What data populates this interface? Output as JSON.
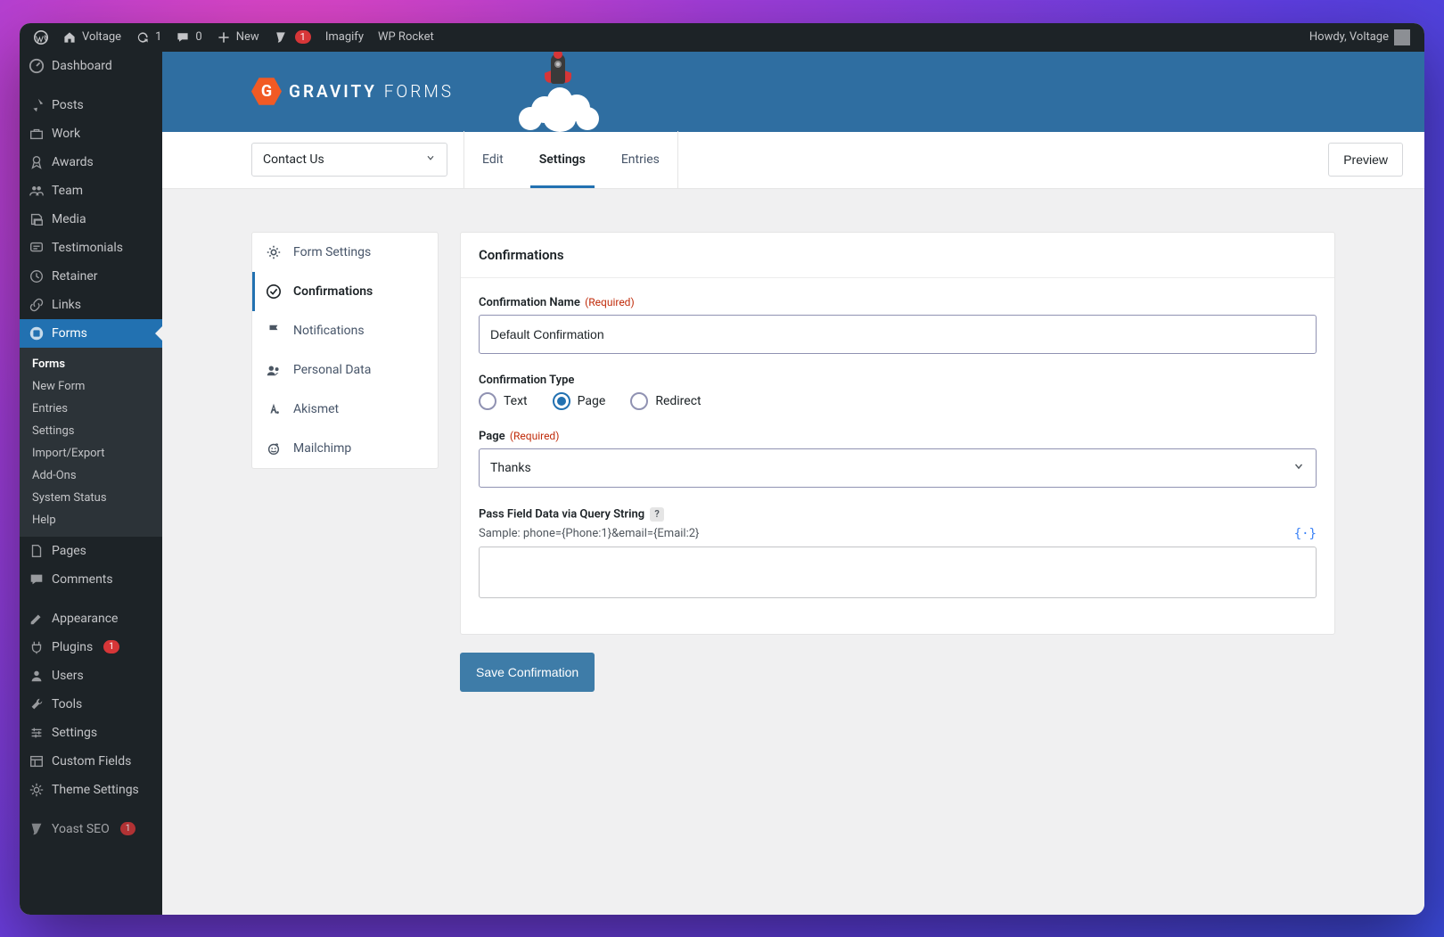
{
  "adminbar": {
    "site": "Voltage",
    "updates": "1",
    "comments": "0",
    "new": "New",
    "yoast_badge": "1",
    "imagify": "Imagify",
    "wp_rocket": "WP Rocket",
    "howdy": "Howdy, Voltage"
  },
  "sidebar": {
    "items": [
      {
        "label": "Dashboard",
        "icon": "dashboard"
      },
      {
        "label": "Posts",
        "icon": "pin"
      },
      {
        "label": "Work",
        "icon": "briefcase"
      },
      {
        "label": "Awards",
        "icon": "award"
      },
      {
        "label": "Team",
        "icon": "team"
      },
      {
        "label": "Media",
        "icon": "media"
      },
      {
        "label": "Testimonials",
        "icon": "quote"
      },
      {
        "label": "Retainer",
        "icon": "clock"
      },
      {
        "label": "Links",
        "icon": "link"
      },
      {
        "label": "Forms",
        "icon": "forms",
        "current": true
      },
      {
        "label": "Pages",
        "icon": "pages"
      },
      {
        "label": "Comments",
        "icon": "comment"
      },
      {
        "label": "Appearance",
        "icon": "appearance"
      },
      {
        "label": "Plugins",
        "icon": "plugin",
        "badge": "1"
      },
      {
        "label": "Users",
        "icon": "user"
      },
      {
        "label": "Tools",
        "icon": "tools"
      },
      {
        "label": "Settings",
        "icon": "settings"
      },
      {
        "label": "Custom Fields",
        "icon": "fields"
      },
      {
        "label": "Theme Settings",
        "icon": "gear"
      },
      {
        "label": "Yoast SEO",
        "icon": "yoast",
        "badge": "1"
      }
    ],
    "submenu": [
      {
        "label": "Forms",
        "current": true
      },
      {
        "label": "New Form"
      },
      {
        "label": "Entries"
      },
      {
        "label": "Settings"
      },
      {
        "label": "Import/Export"
      },
      {
        "label": "Add-Ons"
      },
      {
        "label": "System Status"
      },
      {
        "label": "Help"
      }
    ]
  },
  "banner": {
    "brand_bold": "GRAVITY",
    "brand_light": "FORMS"
  },
  "nav": {
    "form_name": "Contact Us",
    "tabs": [
      {
        "label": "Edit"
      },
      {
        "label": "Settings",
        "active": true
      },
      {
        "label": "Entries"
      }
    ],
    "preview": "Preview"
  },
  "settings_nav": [
    {
      "label": "Form Settings",
      "icon": "gear"
    },
    {
      "label": "Confirmations",
      "icon": "check",
      "active": true
    },
    {
      "label": "Notifications",
      "icon": "flag"
    },
    {
      "label": "Personal Data",
      "icon": "people"
    },
    {
      "label": "Akismet",
      "icon": "akismet"
    },
    {
      "label": "Mailchimp",
      "icon": "mailchimp"
    }
  ],
  "panel": {
    "title": "Confirmations",
    "fields": {
      "name_label": "Confirmation Name",
      "name_required": "(Required)",
      "name_value": "Default Confirmation",
      "type_label": "Confirmation Type",
      "type_options": [
        {
          "label": "Text"
        },
        {
          "label": "Page",
          "checked": true
        },
        {
          "label": "Redirect"
        }
      ],
      "page_label": "Page",
      "page_required": "(Required)",
      "page_value": "Thanks",
      "query_label": "Pass Field Data via Query String",
      "query_sample": "Sample: phone={Phone:1}&email={Email:2}",
      "query_value": ""
    },
    "save_label": "Save Confirmation"
  }
}
